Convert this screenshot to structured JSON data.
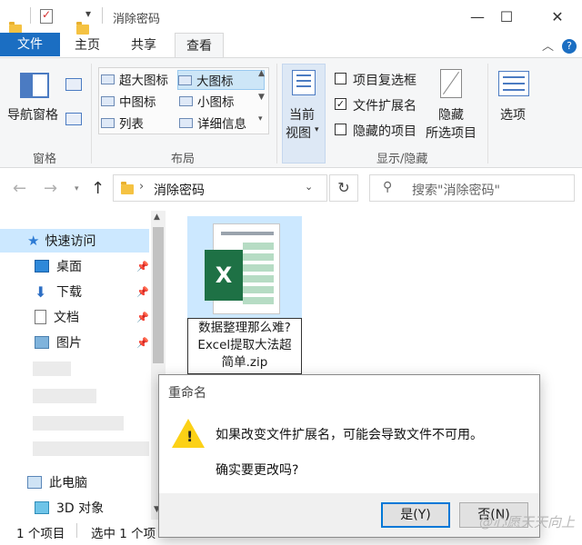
{
  "window": {
    "title": "消除密码",
    "qat_dropdown": "▾"
  },
  "tabs": {
    "file": "文件",
    "home": "主页",
    "share": "共享",
    "view": "查看"
  },
  "ribbon": {
    "nav_pane": "导航窗格",
    "pane_group": "窗格",
    "layout_group": "布局",
    "layouts": {
      "extra_large": "超大图标",
      "large": "大图标",
      "medium": "中图标",
      "small": "小图标",
      "list": "列表",
      "details": "详细信息"
    },
    "current_view_1": "当前",
    "current_view_2": "视图",
    "checkboxes": {
      "item_checkbox": "项目复选框",
      "file_ext": "文件扩展名",
      "hidden_items": "隐藏的项目"
    },
    "hide_selected_1": "隐藏",
    "hide_selected_2": "所选项目",
    "show_hide_group": "显示/隐藏",
    "options": "选项"
  },
  "address": {
    "path": "消除密码",
    "search_placeholder": "搜索\"消除密码\""
  },
  "sidebar": {
    "quick_access": "快速访问",
    "items": [
      {
        "label": "桌面"
      },
      {
        "label": "下载"
      },
      {
        "label": "文档"
      },
      {
        "label": "图片"
      }
    ],
    "this_pc": "此电脑",
    "objects_3d": "3D 对象"
  },
  "file": {
    "name_line1": "数据整理那么难?",
    "name_line2": "Excel提取大法超",
    "name_line3": "简单.zip",
    "icon_letter": "X"
  },
  "dialog": {
    "title": "重命名",
    "message": "如果改变文件扩展名，可能会导致文件不可用。",
    "question": "确实要更改吗?",
    "yes": "是(Y)",
    "no": "否(N)"
  },
  "status": {
    "count": "1 个项目",
    "selected": "选中 1 个项"
  },
  "watermark": "@心愿天天向上",
  "colors": {
    "accent": "#1b6ec2",
    "selection": "#cce8ff",
    "excel_green": "#1e7145",
    "warning": "#fcd116"
  }
}
